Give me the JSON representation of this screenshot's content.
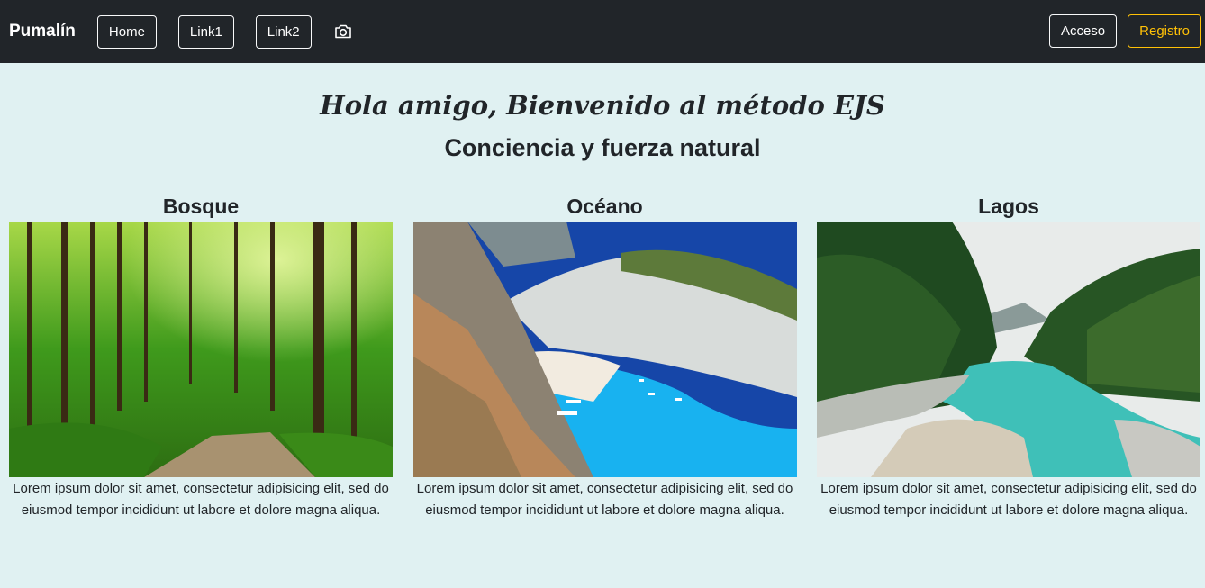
{
  "navbar": {
    "brand": "Pumalín",
    "links": [
      {
        "label": "Home"
      },
      {
        "label": "Link1"
      },
      {
        "label": "Link2"
      }
    ],
    "camera_icon": "camera-icon",
    "login_label": "Acceso",
    "register_label": "Registro"
  },
  "main": {
    "welcome": "Hola amigo, Bienvenido al método EJS",
    "subtitle": "Conciencia y fuerza natural",
    "cards": [
      {
        "title": "Bosque",
        "image": "forest-path-image",
        "text": "Lorem ipsum dolor sit amet, consectetur adipisicing elit, sed do eiusmod tempor incididunt ut labore et dolore magna aliqua."
      },
      {
        "title": "Océano",
        "image": "ocean-cove-image",
        "text": "Lorem ipsum dolor sit amet, consectetur adipisicing elit, sed do eiusmod tempor incididunt ut labore et dolore magna aliqua."
      },
      {
        "title": "Lagos",
        "image": "river-lake-image",
        "text": "Lorem ipsum dolor sit amet, consectetur adipisicing elit, sed do eiusmod tempor incididunt ut labore et dolore magna aliqua."
      }
    ]
  },
  "colors": {
    "navbar_bg": "#212529",
    "page_bg": "#e0f1f2",
    "warning": "#ffc107"
  }
}
